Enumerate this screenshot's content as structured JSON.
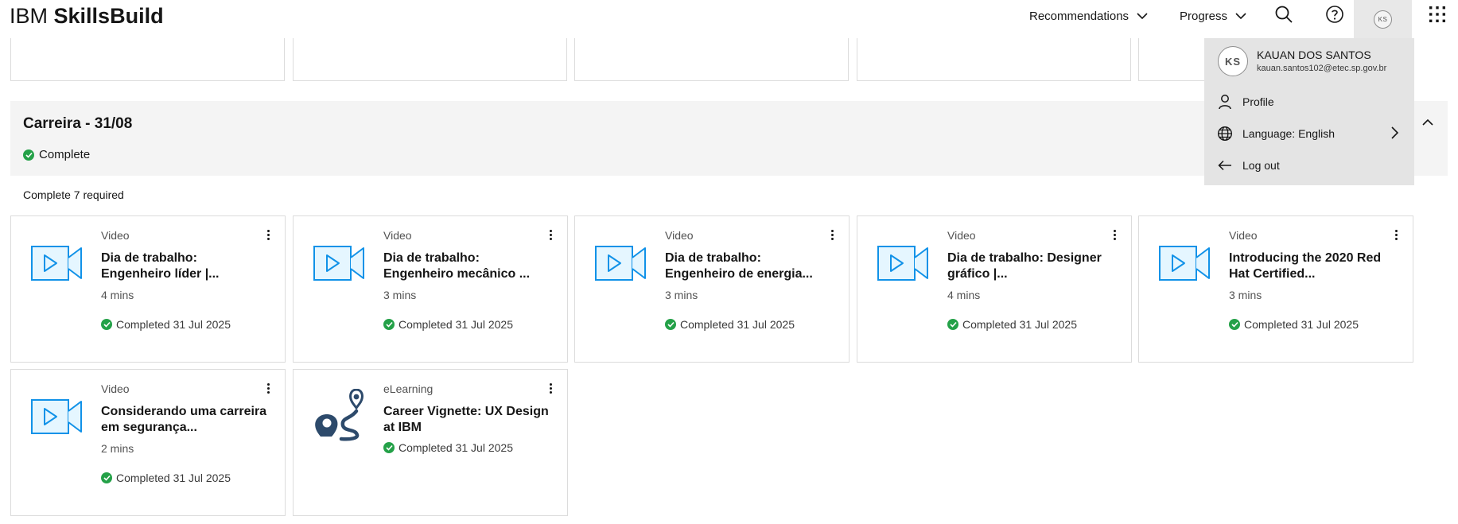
{
  "header": {
    "brand_regular": "IBM",
    "brand_bold": "SkillsBuild",
    "nav": [
      {
        "label": "Recommendations"
      },
      {
        "label": "Progress"
      }
    ],
    "avatar_initials": "KS"
  },
  "account_menu": {
    "initials": "KS",
    "name": "KAUAN DOS SANTOS",
    "email": "kauan.santos102@etec.sp.gov.br",
    "items": [
      {
        "label": "Profile",
        "icon": "user-icon"
      },
      {
        "label": "Language: English",
        "icon": "globe-icon"
      },
      {
        "label": "Log out",
        "icon": "arrow-left-icon"
      }
    ]
  },
  "section": {
    "title": "Carreira - 31/08",
    "status": "Complete",
    "required_text": "Complete 7 required"
  },
  "cards": [
    {
      "kind": "Video",
      "title": "Dia de trabalho: Engenheiro líder |...",
      "duration": "4 mins",
      "completed": "Completed 31 Jul 2025"
    },
    {
      "kind": "Video",
      "title": "Dia de trabalho: Engenheiro mecânico ...",
      "duration": "3 mins",
      "completed": "Completed 31 Jul 2025"
    },
    {
      "kind": "Video",
      "title": "Dia de trabalho: Engenheiro de energia...",
      "duration": "3 mins",
      "completed": "Completed 31 Jul 2025"
    },
    {
      "kind": "Video",
      "title": "Dia de trabalho: Designer gráfico |...",
      "duration": "4 mins",
      "completed": "Completed 31 Jul 2025"
    },
    {
      "kind": "Video",
      "title": "Introducing the 2020 Red Hat Certified...",
      "duration": "3 mins",
      "completed": "Completed 31 Jul 2025"
    },
    {
      "kind": "Video",
      "title": "Considerando uma carreira em segurança...",
      "duration": "2 mins",
      "completed": "Completed 31 Jul 2025"
    },
    {
      "kind": "eLearning",
      "title": "Career Vignette: UX Design at IBM",
      "duration": "",
      "completed": "Completed 31 Jul 2025"
    }
  ],
  "colors": {
    "video_icon_stroke": "#1192e8",
    "video_icon_fill": "#e5f6ff",
    "elearning_icon": "#2d4a6b",
    "success": "#24a148",
    "section_bg": "#f4f4f4",
    "menu_bg": "#e4e4e4"
  }
}
